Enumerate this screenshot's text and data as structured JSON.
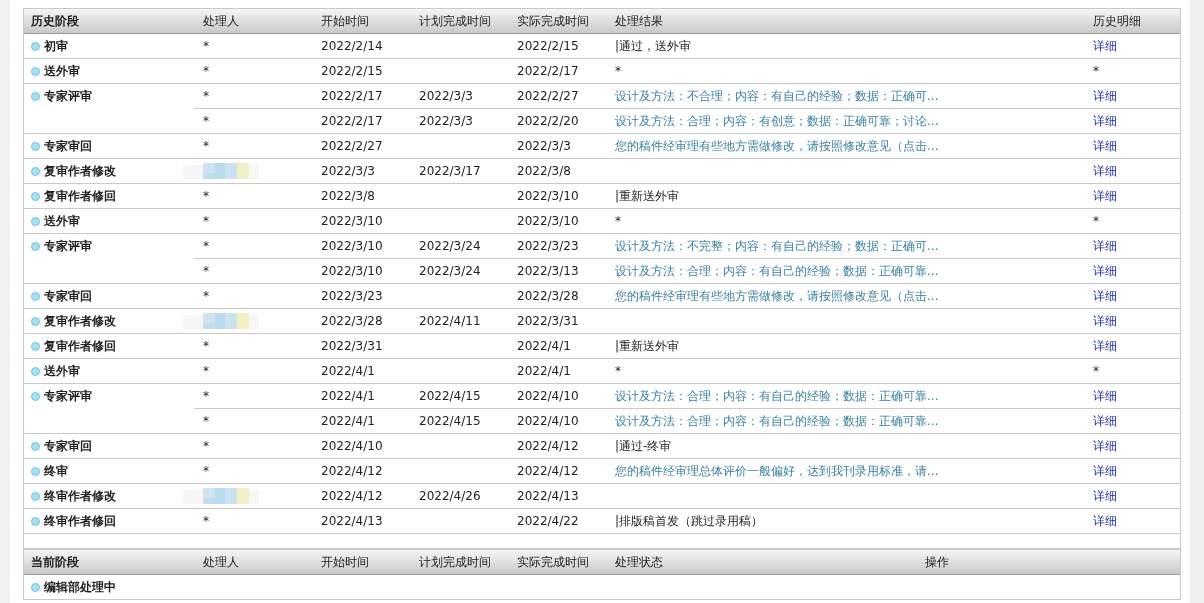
{
  "history": {
    "columns": [
      "历史阶段",
      "处理人",
      "开始时间",
      "计划完成时间",
      "实际完成时间",
      "处理结果",
      "历史明细"
    ],
    "stages": [
      {
        "name": "初审",
        "entries": [
          {
            "handler": "*",
            "start": "2022/2/14",
            "actual": "2022/2/15",
            "result": {
              "text": "|通过，送外审",
              "kind": "plain"
            },
            "detail": {
              "text": "详细",
              "kind": "link"
            }
          }
        ]
      },
      {
        "name": "送外审",
        "entries": [
          {
            "handler": "*",
            "start": "2022/2/15",
            "actual": "2022/2/17",
            "result": {
              "text": "*",
              "kind": "plain"
            },
            "detail": {
              "text": "*",
              "kind": "plain"
            }
          }
        ]
      },
      {
        "name": "专家评审",
        "entries": [
          {
            "handler": "*",
            "start": "2022/2/17",
            "plan": "2022/3/3",
            "actual": "2022/2/27",
            "result": {
              "text": "设计及方法：不合理；内容：有自己的经验；数据：正确可...",
              "kind": "link"
            },
            "detail": {
              "text": "详细",
              "kind": "link"
            }
          },
          {
            "handler": "*",
            "start": "2022/2/17",
            "plan": "2022/3/3",
            "actual": "2022/2/20",
            "result": {
              "text": "设计及方法：合理；内容：有创意；数据：正确可靠；讨论...",
              "kind": "link"
            },
            "detail": {
              "text": "详细",
              "kind": "link"
            }
          }
        ]
      },
      {
        "name": "专家审回",
        "entries": [
          {
            "handler": "*",
            "start": "2022/2/27",
            "actual": "2022/3/3",
            "result": {
              "text": "您的稿件经审理有些地方需做修改，请按照修改意见（点击...",
              "kind": "link"
            },
            "detail": {
              "text": "详细",
              "kind": "link"
            }
          }
        ]
      },
      {
        "name": "复审作者修改",
        "entries": [
          {
            "handler_blurred": true,
            "start": "2022/3/3",
            "plan": "2022/3/17",
            "actual": "2022/3/8",
            "detail": {
              "text": "详细",
              "kind": "link"
            }
          }
        ]
      },
      {
        "name": "复审作者修回",
        "entries": [
          {
            "handler": "*",
            "start": "2022/3/8",
            "actual": "2022/3/10",
            "result": {
              "text": "|重新送外审",
              "kind": "plain"
            },
            "detail": {
              "text": "详细",
              "kind": "link"
            }
          }
        ]
      },
      {
        "name": "送外审",
        "entries": [
          {
            "handler": "*",
            "start": "2022/3/10",
            "actual": "2022/3/10",
            "result": {
              "text": "*",
              "kind": "plain"
            },
            "detail": {
              "text": "*",
              "kind": "plain"
            }
          }
        ]
      },
      {
        "name": "专家评审",
        "entries": [
          {
            "handler": "*",
            "start": "2022/3/10",
            "plan": "2022/3/24",
            "actual": "2022/3/23",
            "result": {
              "text": "设计及方法：不完整；内容：有自己的经验；数据：正确可...",
              "kind": "link"
            },
            "detail": {
              "text": "详细",
              "kind": "link"
            }
          },
          {
            "handler": "*",
            "start": "2022/3/10",
            "plan": "2022/3/24",
            "actual": "2022/3/13",
            "result": {
              "text": "设计及方法：合理；内容：有自己的经验；数据：正确可靠...",
              "kind": "link"
            },
            "detail": {
              "text": "详细",
              "kind": "link"
            }
          }
        ]
      },
      {
        "name": "专家审回",
        "entries": [
          {
            "handler": "*",
            "start": "2022/3/23",
            "actual": "2022/3/28",
            "result": {
              "text": "您的稿件经审理有些地方需做修改，请按照修改意见（点击...",
              "kind": "link"
            },
            "detail": {
              "text": "详细",
              "kind": "link"
            }
          }
        ]
      },
      {
        "name": "复审作者修改",
        "entries": [
          {
            "handler_blurred": true,
            "start": "2022/3/28",
            "plan": "2022/4/11",
            "actual": "2022/3/31",
            "detail": {
              "text": "详细",
              "kind": "link"
            }
          }
        ]
      },
      {
        "name": "复审作者修回",
        "entries": [
          {
            "handler": "*",
            "start": "2022/3/31",
            "actual": "2022/4/1",
            "result": {
              "text": "|重新送外审",
              "kind": "plain"
            },
            "detail": {
              "text": "详细",
              "kind": "link"
            }
          }
        ]
      },
      {
        "name": "送外审",
        "entries": [
          {
            "handler": "*",
            "start": "2022/4/1",
            "actual": "2022/4/1",
            "result": {
              "text": "*",
              "kind": "plain"
            },
            "detail": {
              "text": "*",
              "kind": "plain"
            }
          }
        ]
      },
      {
        "name": "专家评审",
        "entries": [
          {
            "handler": "*",
            "start": "2022/4/1",
            "plan": "2022/4/15",
            "actual": "2022/4/10",
            "result": {
              "text": "设计及方法：合理；内容：有自己的经验；数据：正确可靠...",
              "kind": "link"
            },
            "detail": {
              "text": "详细",
              "kind": "link"
            }
          },
          {
            "handler": "*",
            "start": "2022/4/1",
            "plan": "2022/4/15",
            "actual": "2022/4/10",
            "result": {
              "text": "设计及方法：合理；内容：有自己的经验；数据：正确可靠...",
              "kind": "link"
            },
            "detail": {
              "text": "详细",
              "kind": "link"
            }
          }
        ]
      },
      {
        "name": "专家审回",
        "entries": [
          {
            "handler": "*",
            "start": "2022/4/10",
            "actual": "2022/4/12",
            "result": {
              "text": "|通过-终审",
              "kind": "plain"
            },
            "detail": {
              "text": "详细",
              "kind": "link"
            }
          }
        ]
      },
      {
        "name": "终审",
        "entries": [
          {
            "handler": "*",
            "start": "2022/4/12",
            "actual": "2022/4/12",
            "result": {
              "text": "您的稿件经审理总体评价一般偏好，达到我刊录用标准，请...",
              "kind": "link"
            },
            "detail": {
              "text": "详细",
              "kind": "link"
            }
          }
        ]
      },
      {
        "name": "终审作者修改",
        "entries": [
          {
            "handler_blurred": true,
            "start": "2022/4/12",
            "plan": "2022/4/26",
            "actual": "2022/4/13",
            "detail": {
              "text": "详细",
              "kind": "link"
            }
          }
        ]
      },
      {
        "name": "终审作者修回",
        "entries": [
          {
            "handler": "*",
            "start": "2022/4/13",
            "actual": "2022/4/22",
            "result": {
              "text": "|排版稿首发（跳过录用稿）",
              "kind": "plain"
            },
            "detail": {
              "text": "详细",
              "kind": "link"
            }
          }
        ]
      }
    ]
  },
  "current": {
    "columns": [
      "当前阶段",
      "处理人",
      "开始时间",
      "计划完成时间",
      "实际完成时间",
      "处理状态",
      "操作"
    ],
    "stages": [
      {
        "name": "编辑部处理中"
      }
    ]
  }
}
